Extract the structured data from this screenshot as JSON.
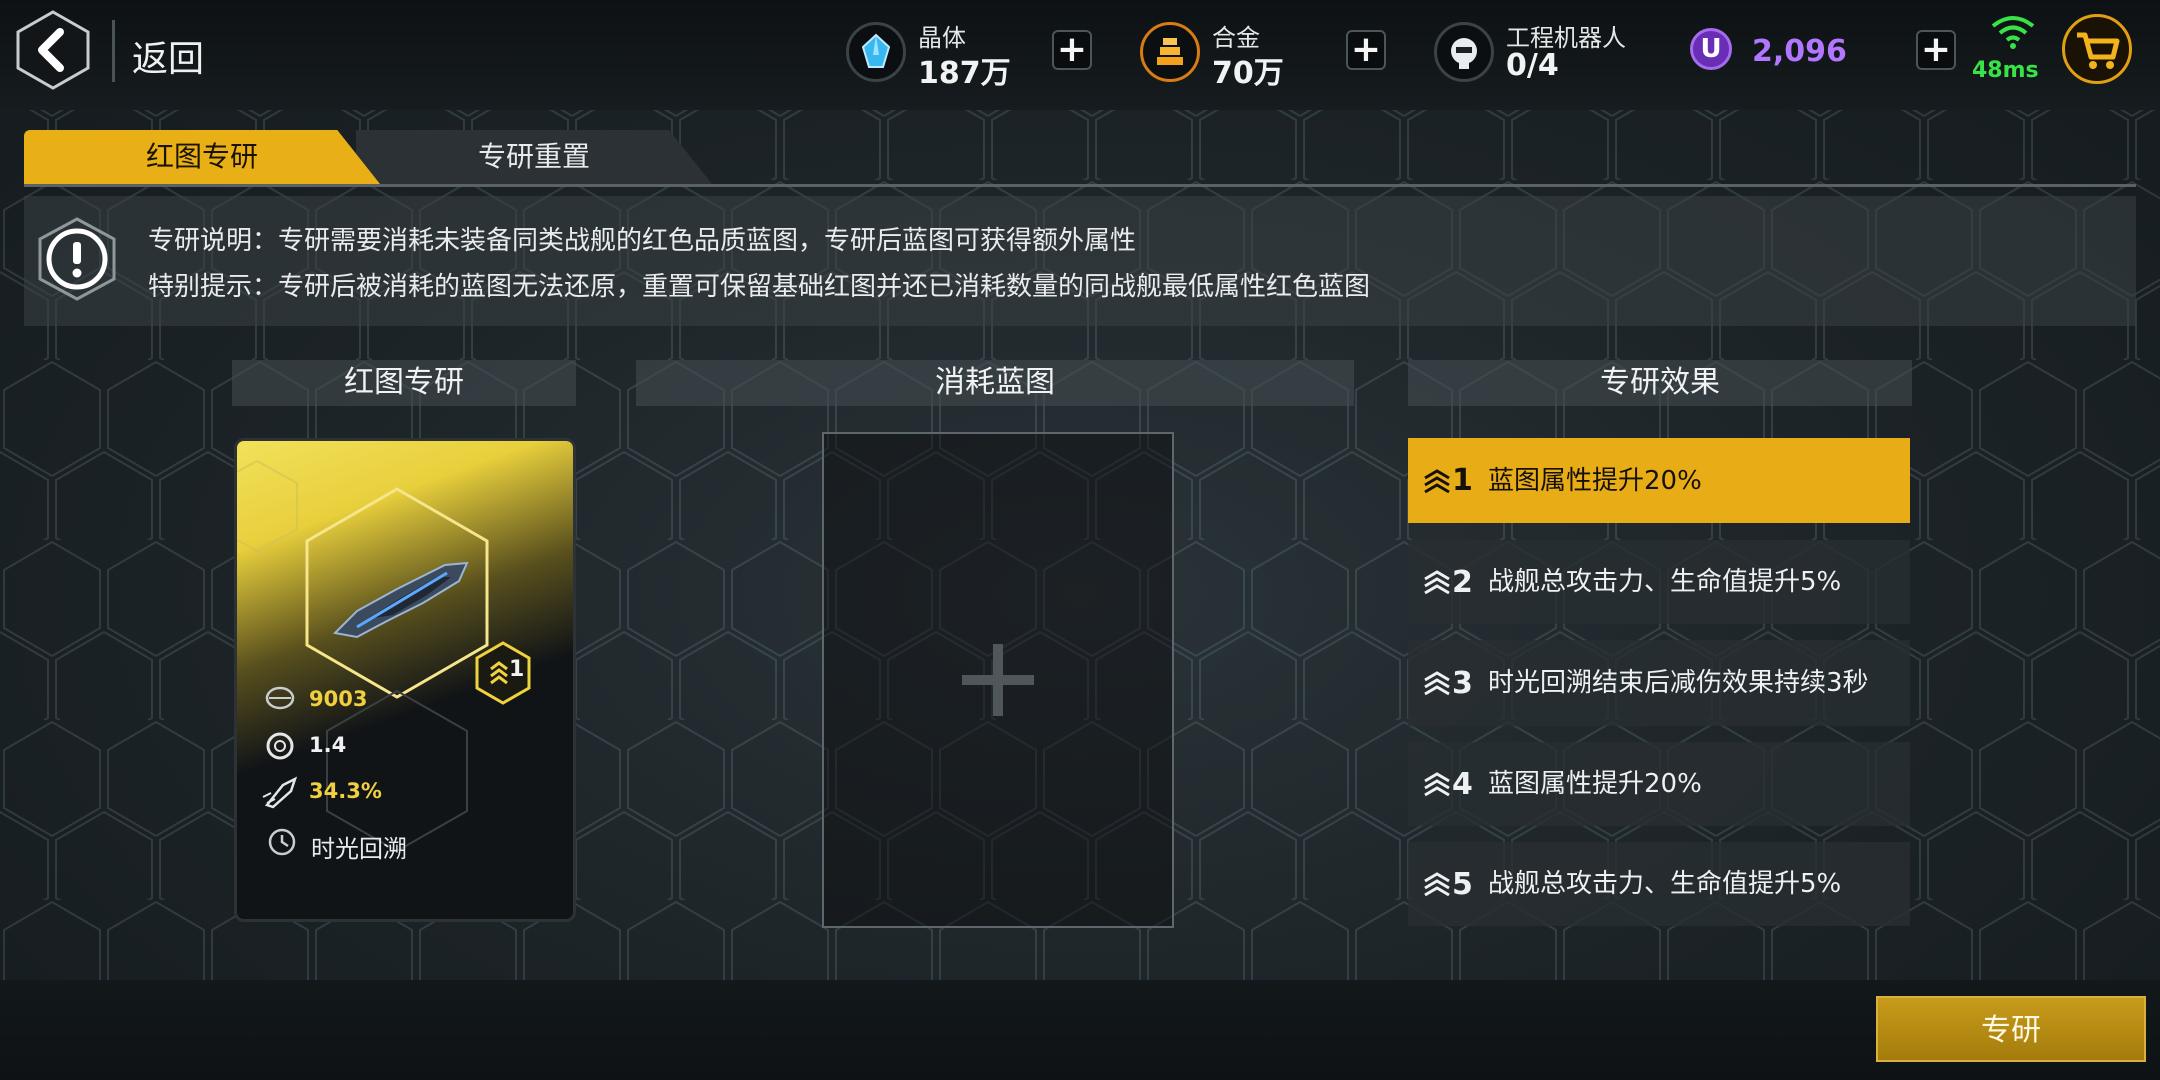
{
  "header": {
    "back_label": "返回",
    "resources": [
      {
        "name": "晶体",
        "value": "187万",
        "icon": "crystal-icon"
      },
      {
        "name": "合金",
        "value": "70万",
        "icon": "alloy-icon"
      },
      {
        "name": "工程机器人",
        "value": "0/4",
        "icon": "robot-icon"
      }
    ],
    "currency_symbol": "U",
    "currency_value": "2,096",
    "ping": "48ms",
    "plus_symbol": "+"
  },
  "tabs": [
    {
      "label": "红图专研",
      "active": true
    },
    {
      "label": "专研重置",
      "active": false
    }
  ],
  "info": {
    "line1": "专研说明：专研需要消耗未装备同类战舰的红色品质蓝图，专研后蓝图可获得额外属性",
    "line2": "特别提示：专研后被消耗的蓝图无法还原，重置可保留基础红图并还已消耗数量的同战舰最低属性红色蓝图"
  },
  "sections": {
    "blueprint": "红图专研",
    "consume": "消耗蓝图",
    "effects": "专研效果"
  },
  "card": {
    "level": "1",
    "power": "9003",
    "speed": "1.4",
    "rate": "34.3%",
    "skill": "时光回溯"
  },
  "effects": [
    {
      "num": "1",
      "text": "蓝图属性提升20%",
      "selected": true
    },
    {
      "num": "2",
      "text": "战舰总攻击力、生命值提升5%",
      "selected": false
    },
    {
      "num": "3",
      "text": "时光回溯结束后减伤效果持续3秒",
      "selected": false
    },
    {
      "num": "4",
      "text": "蓝图属性提升20%",
      "selected": false
    },
    {
      "num": "5",
      "text": "战舰总攻击力、生命值提升5%",
      "selected": false
    }
  ],
  "actions": {
    "research": "专研"
  },
  "colors": {
    "accent": "#e8ad16",
    "currency": "#b276ff",
    "ping": "#37e346"
  }
}
